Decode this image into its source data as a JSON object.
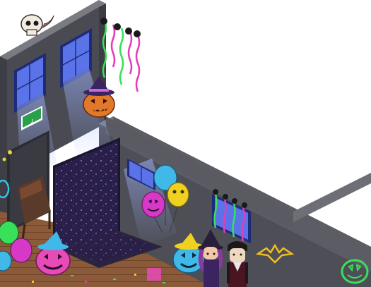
{
  "scene": {
    "exit_sign_arrow": "↓",
    "room_theme_colors": {
      "wall_dark": "#4a4a52",
      "wall_mid": "#6b6b73",
      "wall_light": "#8c8c94",
      "window_blue": "#5a73e8",
      "floor_wood": "#8a5a3a",
      "star_curtain": "#2a1f4a",
      "pumpkin_orange": "#e07a2a",
      "neon_green": "#39e05a",
      "neon_pink": "#e83ab8",
      "neon_cyan": "#30c8e8",
      "balloon_yellow": "#f0d020",
      "balloon_magenta": "#d838c8",
      "balloon_cyan": "#40b8e8"
    },
    "objects": [
      "skull-on-ledge",
      "hanging-spider-streamers",
      "jack-o-lantern-witch-hat",
      "exit-sign",
      "starry-curtain-doorway",
      "spooky-balloons",
      "glowing-pumpkins",
      "stacked-chairs",
      "neon-bat-sign",
      "neon-skull-sign",
      "avatar-witch",
      "avatar-vampire"
    ]
  }
}
